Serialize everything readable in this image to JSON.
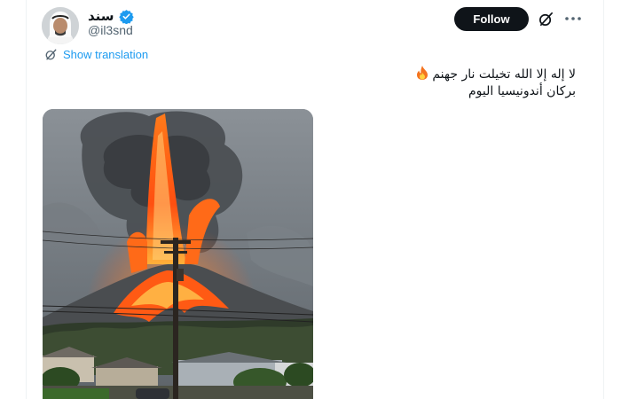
{
  "tweet": {
    "author": {
      "display_name": "سند",
      "handle": "@il3snd",
      "verified": true
    },
    "follow_label": "Follow",
    "show_translation_label": "Show translation",
    "text_lines": [
      "لا إله إلا الله تخيلت نار جهنم",
      "بركان أندونيسيا اليوم"
    ],
    "emoji": "fire-icon",
    "media": {
      "kind": "video-thumbnail",
      "subject": "volcano eruption"
    }
  },
  "icons": {
    "verified": "verified-badge-icon",
    "grok": "grok-icon",
    "more": "more-options-icon",
    "translate": "translate-icon"
  },
  "colors": {
    "accent": "#1d9bf0",
    "follow_bg": "#0f1419",
    "secondary_text": "#536471",
    "lava": "#ff5a14"
  }
}
